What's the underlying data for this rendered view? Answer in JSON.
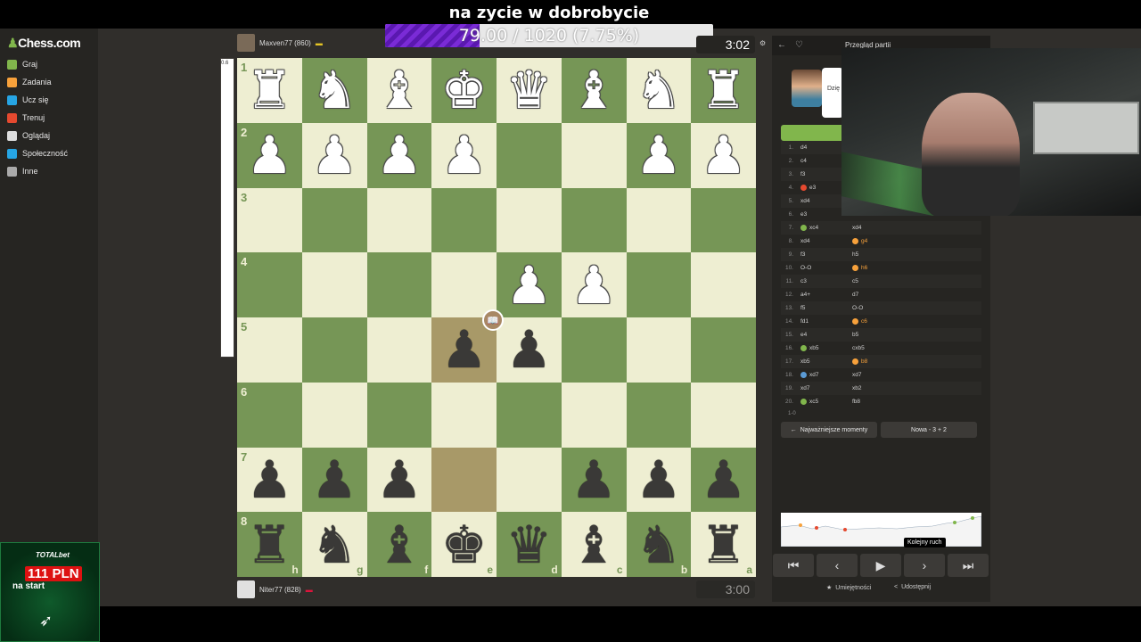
{
  "overlay": {
    "stream_title": "na zycie w dobrobycie",
    "goal_text": "79.00 / 1020 (7.75%)",
    "goal_fraction": 0.0775,
    "totalbet_brand": "TOTALbet",
    "totalbet_amount": "111 PLN",
    "totalbet_caption": "na start"
  },
  "sidebar": {
    "logo": "Chess.com",
    "items": [
      {
        "label": "Graj",
        "color": "#81b64c"
      },
      {
        "label": "Zadania",
        "color": "#f7a13b"
      },
      {
        "label": "Ucz się",
        "color": "#26a5e4"
      },
      {
        "label": "Trenuj",
        "color": "#e5492f"
      },
      {
        "label": "Oglądaj",
        "color": "#dddddd"
      },
      {
        "label": "Społeczność",
        "color": "#26a5e4"
      },
      {
        "label": "Inne",
        "color": "#aaaaaa"
      }
    ]
  },
  "game": {
    "top_player": "Maxven77 (860)",
    "top_clock": "3:02",
    "bottom_player": "Niter77 (828)",
    "bottom_clock": "3:00",
    "eval_label": "0.6",
    "board": [
      [
        "wR",
        "wN",
        "wB",
        "wK",
        "wQ",
        "wB",
        "wN",
        "wR"
      ],
      [
        "wP",
        "wP",
        "wP",
        "wP",
        "",
        "",
        "wP",
        "wP"
      ],
      [
        "",
        "",
        "",
        "",
        "",
        "",
        "",
        ""
      ],
      [
        "",
        "",
        "",
        "",
        "wP",
        "wP",
        "",
        ""
      ],
      [
        "",
        "",
        "",
        "bP",
        "bP",
        "",
        "",
        ""
      ],
      [
        "",
        "",
        "",
        "",
        "",
        "",
        "",
        ""
      ],
      [
        "bP",
        "bP",
        "bP",
        "",
        "",
        "bP",
        "bP",
        "bP"
      ],
      [
        "bR",
        "bN",
        "bB",
        "bK",
        "bQ",
        "bB",
        "bN",
        "bR"
      ]
    ],
    "ranks": [
      "1",
      "2",
      "3",
      "4",
      "5",
      "6",
      "7",
      "8"
    ],
    "files": [
      "h",
      "g",
      "f",
      "e",
      "d",
      "c",
      "b",
      "a"
    ],
    "highlight_squares": [
      "r4c3",
      "r6c3"
    ]
  },
  "panel": {
    "header_title": "Przegląd partii",
    "moves": [
      {
        "n": "1.",
        "w": "d4",
        "b": ""
      },
      {
        "n": "2.",
        "w": "c4",
        "b": ""
      },
      {
        "n": "3.",
        "w": "f3",
        "b": ""
      },
      {
        "n": "4.",
        "w": "e3",
        "b": ""
      },
      {
        "n": "5.",
        "w": "xd4",
        "b": ""
      },
      {
        "n": "6.",
        "w": "e3",
        "b": ""
      },
      {
        "n": "7.",
        "w": "xc4",
        "b": "xd4"
      },
      {
        "n": "8.",
        "w": "xd4",
        "b": "g4"
      },
      {
        "n": "9.",
        "w": "f3",
        "b": "h5"
      },
      {
        "n": "10.",
        "w": "O-O",
        "b": "h6"
      },
      {
        "n": "11.",
        "w": "c3",
        "b": "c5"
      },
      {
        "n": "12.",
        "w": "a4+",
        "b": "d7"
      },
      {
        "n": "13.",
        "w": "f5",
        "b": "O-O"
      },
      {
        "n": "14.",
        "w": "fd1",
        "b": "c6"
      },
      {
        "n": "15.",
        "w": "e4",
        "b": "b5"
      },
      {
        "n": "16.",
        "w": "xb5",
        "b": "cxb5"
      },
      {
        "n": "17.",
        "w": "xb5",
        "b": "b8"
      },
      {
        "n": "18.",
        "w": "xd7",
        "b": "xd7"
      },
      {
        "n": "19.",
        "w": "xd7",
        "b": "xb2"
      },
      {
        "n": "20.",
        "w": "xc5",
        "b": "fb8"
      }
    ],
    "result": "1-0",
    "key_moments_label": "Najważniejsze momenty",
    "new_game_label": "Nowa - 3 + 2",
    "tooltip": "Kolejny ruch",
    "skills_label": "Umiejętności",
    "share_label": "Udostępnij",
    "coach_text": "Dzię",
    "nav": [
      "⏮",
      "‹",
      "▶",
      "›",
      "⏭"
    ]
  }
}
